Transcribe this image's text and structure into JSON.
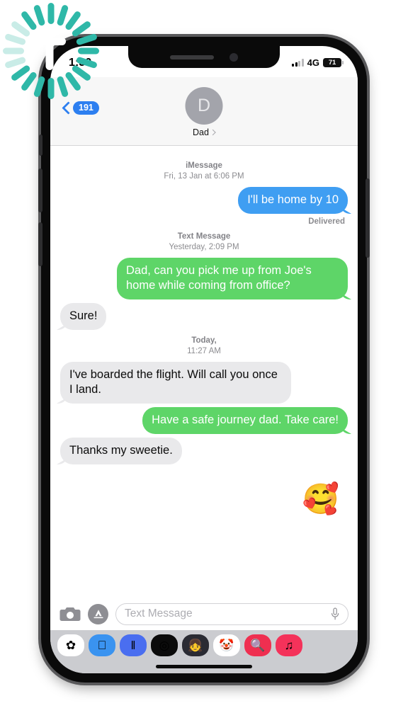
{
  "device": {
    "status_bar": {
      "time": "1:30",
      "network": "4G",
      "battery_percent": "71",
      "signal_icon": "cellular-signal-icon",
      "battery_icon": "battery-icon"
    },
    "home_indicator": "home-indicator"
  },
  "watermark": {
    "letter": "T",
    "burst_color": "#2fb8a8",
    "burst_color_light": "#c9ece7",
    "name": "starburst-logo"
  },
  "nav": {
    "back_badge": "191",
    "back_icon": "chevron-left-icon",
    "avatar_initial": "D",
    "contact_name": "Dad",
    "contact_chevron_icon": "chevron-right-icon"
  },
  "colors": {
    "bubble_blue": "#3f9ef2",
    "bubble_green": "#5ed568",
    "bubble_gray": "#e9e9eb",
    "accent_blue": "#2d7ff0",
    "nav_background": "#f7f7f7",
    "drawer_background": "#cbccd0"
  },
  "thread": [
    {
      "kind": "timestamp",
      "label": "iMessage",
      "detail": "Fri, 13 Jan at 6:06 PM"
    },
    {
      "kind": "message",
      "side": "out",
      "style": "blue",
      "text": "I'll be home by 10"
    },
    {
      "kind": "status",
      "text": "Delivered"
    },
    {
      "kind": "timestamp",
      "label": "Text Message",
      "detail": "Yesterday, 2:09 PM"
    },
    {
      "kind": "message",
      "side": "out",
      "style": "green",
      "text": "Dad, can you pick me up from Joe's home while coming from office?"
    },
    {
      "kind": "message",
      "side": "in",
      "style": "gray",
      "text": "Sure!"
    },
    {
      "kind": "timestamp",
      "label": "Today,",
      "detail": "11:27 AM"
    },
    {
      "kind": "message",
      "side": "in",
      "style": "gray",
      "text": "I've boarded the flight. Will call you once I land."
    },
    {
      "kind": "message",
      "side": "out",
      "style": "green",
      "text": "Have a safe journey dad. Take care!"
    },
    {
      "kind": "message",
      "side": "in",
      "style": "gray",
      "text": "Thanks my sweetie."
    },
    {
      "kind": "emoji",
      "text": "🥰"
    }
  ],
  "input_bar": {
    "camera_icon": "camera-icon",
    "apps_icon": "app-store-icon",
    "placeholder": "Text Message",
    "mic_icon": "microphone-icon"
  },
  "app_drawer": [
    {
      "name": "photos-app-icon",
      "glyph": "✿",
      "bg": "#ffffff"
    },
    {
      "name": "app-store-app-icon",
      "glyph": "",
      "bg": "#3a93f0"
    },
    {
      "name": "audio-message-icon",
      "glyph": "‖",
      "bg": "#4a6ef0"
    },
    {
      "name": "activity-rings-icon",
      "glyph": "◎",
      "bg": "#0b0b0b"
    },
    {
      "name": "memoji-sticker-icon",
      "glyph": "👧",
      "bg": "#2a2b33"
    },
    {
      "name": "animoji-icon",
      "glyph": "🤡",
      "bg": "#ffffff"
    },
    {
      "name": "image-search-icon",
      "glyph": "🔍",
      "bg": "#ef2f50"
    },
    {
      "name": "apple-music-icon",
      "glyph": "♫",
      "bg": "#f4325a"
    }
  ]
}
